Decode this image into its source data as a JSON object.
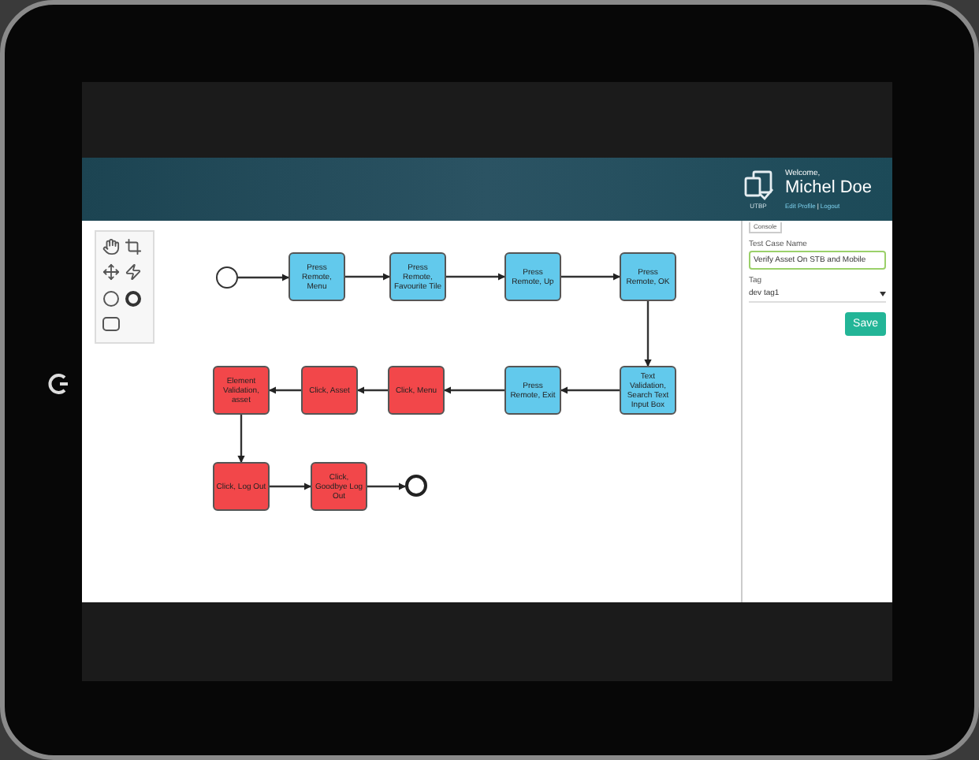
{
  "header": {
    "logo_caption": "UTBP",
    "welcome": "Welcome,",
    "user_name": "Michel Doe",
    "links": [
      {
        "label": "Edit Profile"
      },
      {
        "label": "Logout"
      }
    ],
    "link_separator": "|"
  },
  "flow": {
    "rows": [
      {
        "reversed": false,
        "nodes": [
          {
            "label": "Press Remote, Menu",
            "color": "#62c9ec"
          },
          {
            "label": "Press Remote, Favourite Tile",
            "color": "#62c9ec"
          },
          {
            "label": "Press Remote, Up",
            "color": "#62c9ec"
          },
          {
            "label": "Press Remote, OK",
            "color": "#62c9ec"
          }
        ]
      },
      {
        "reversed": true,
        "nodes": [
          {
            "label": "Element Validation, asset",
            "color": "#f2474a"
          },
          {
            "label": "Click, Asset",
            "color": "#f2474a"
          },
          {
            "label": "Click, Menu",
            "color": "#f2474a"
          },
          {
            "label": "Press Remote, Exit",
            "color": "#62c9ec"
          },
          {
            "label": "Text Validation, Search Text Input Box",
            "color": "#62c9ec"
          }
        ]
      },
      {
        "reversed": false,
        "nodes": [
          {
            "label": "Click, Log Out",
            "color": "#f2474a"
          },
          {
            "label": "Click, Goodbye Log Out",
            "color": "#f2474a"
          }
        ]
      }
    ]
  },
  "panel": {
    "tab": "Console",
    "name_label": "Test Case Name",
    "name_value": "Verify Asset On STB and Mobile",
    "tag_label": "Tag",
    "tag_value": "dev tag1",
    "save": "Save"
  }
}
